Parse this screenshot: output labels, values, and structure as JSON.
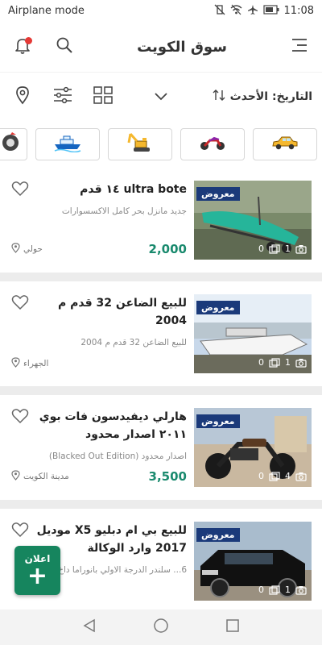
{
  "status": {
    "mode": "Airplane mode",
    "time": "11:08"
  },
  "header": {
    "title": "سوق الكويت"
  },
  "toolbar": {
    "sort_label": "التاريخ: الأحدث"
  },
  "categories": [
    "car",
    "motorcycle",
    "construction-equipment",
    "boat",
    "parts"
  ],
  "colors": {
    "accent": "#16855e",
    "price": "#1a8a6e",
    "tag_bg": "#1b3a7a",
    "notification": "#e53935"
  },
  "listings": [
    {
      "title": "ultra bote ١٤ قدم",
      "desc": "جديد مانزل بحر كامل الاكسسوارات",
      "location": "حولي",
      "price": "2,000",
      "tag": "معروض",
      "photos": "1",
      "views": "0"
    },
    {
      "title": "للبيع الضاعن 32 قدم م 2004",
      "desc": "للبيع الضاعن 32 قدم م 2004",
      "location": "الجهراء",
      "price": "",
      "tag": "معروض",
      "photos": "1",
      "views": "0"
    },
    {
      "title": "هارلي ديفيدسون فات بوي ٢٠١١ اصدار محدود",
      "desc": "اصدار محدود (Blacked Out Edition)",
      "location": "مدينة الكويت",
      "price": "3,500",
      "tag": "معروض",
      "photos": "4",
      "views": "0"
    },
    {
      "title": "للبيع بي ام دبليو X5 موديل 2017 وارد الوكالة",
      "desc": "6... سلندر الدرجة الاولي بانوراما داخ",
      "location": "",
      "price": "",
      "tag": "معروض",
      "photos": "1",
      "views": "0"
    }
  ],
  "fab": {
    "label": "اعلان",
    "plus": "+"
  }
}
